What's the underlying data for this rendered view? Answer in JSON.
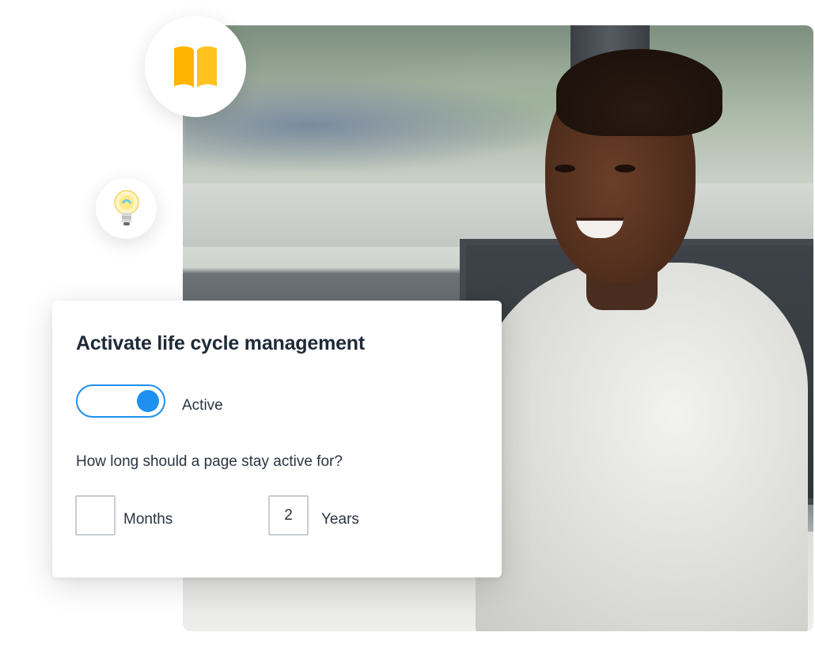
{
  "card": {
    "title": "Activate life cycle management",
    "toggle": {
      "state": "on",
      "label": "Active",
      "color": "#1e90f0"
    },
    "question": "How long should a page stay active for?",
    "months": {
      "value": "",
      "label": "Months"
    },
    "years": {
      "value": "2",
      "label": "Years"
    }
  },
  "badges": {
    "top_icon": "book-icon",
    "top_icon_color": "#ffb400",
    "side_icon": "lightbulb-icon"
  },
  "photo": {
    "subject": "smiling-man-at-desk"
  }
}
